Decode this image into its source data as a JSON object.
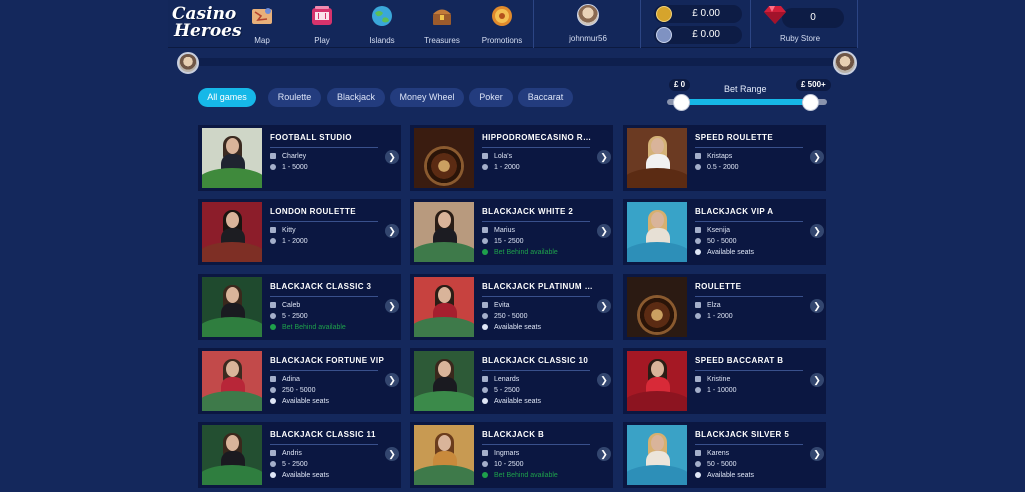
{
  "header": {
    "logo_line1": "Casino",
    "logo_line2": "Heroes",
    "nav": [
      {
        "label": "Map",
        "icon": "map-icon"
      },
      {
        "label": "Play",
        "icon": "slot-machine-icon"
      },
      {
        "label": "Islands",
        "icon": "globe-icon"
      },
      {
        "label": "Treasures",
        "icon": "treasure-chest-icon"
      },
      {
        "label": "Promotions",
        "icon": "promotion-wheel-icon"
      }
    ],
    "username": "johnmur56",
    "balances": [
      {
        "amount": "£ 0.00",
        "icon": "gold-coin-icon",
        "color": "#d6a42c"
      },
      {
        "amount": "£ 0.00",
        "icon": "silver-coin-icon",
        "color": "#9fb1d6"
      }
    ],
    "ruby_count": "0",
    "ruby_label": "Ruby Store"
  },
  "filters": {
    "items": [
      "All games",
      "Roulette",
      "Blackjack",
      "Money Wheel",
      "Poker",
      "Baccarat"
    ],
    "active": "All games"
  },
  "bet_range": {
    "label": "Bet Range",
    "min_label": "£ 0",
    "max_label": "£ 500+"
  },
  "games": [
    {
      "title": "FOOTBALL STUDIO",
      "dealer": "Charley",
      "limits": "1 - 5000",
      "status": ""
    },
    {
      "title": "HIPPODROMECASINO ROULETTE",
      "dealer": "Lola's",
      "limits": "1 - 2000",
      "status": ""
    },
    {
      "title": "SPEED ROULETTE",
      "dealer": "Kristaps",
      "limits": "0.5 - 2000",
      "status": ""
    },
    {
      "title": "LONDON ROULETTE",
      "dealer": "Kitty",
      "limits": "1 - 2000",
      "status": ""
    },
    {
      "title": "BLACKJACK WHITE 2",
      "dealer": "Marius",
      "limits": "15 - 2500",
      "status": "Bet Behind available"
    },
    {
      "title": "BLACKJACK VIP A",
      "dealer": "Ksenija",
      "limits": "50 - 5000",
      "status": "Available seats"
    },
    {
      "title": "BLACKJACK CLASSIC 3",
      "dealer": "Caleb",
      "limits": "5 - 2500",
      "status": "Bet Behind available"
    },
    {
      "title": "BLACKJACK PLATINUM VIP",
      "dealer": "Evita",
      "limits": "250 - 5000",
      "status": "Available seats"
    },
    {
      "title": "ROULETTE",
      "dealer": "Elza",
      "limits": "1 - 2000",
      "status": ""
    },
    {
      "title": "BLACKJACK FORTUNE VIP",
      "dealer": "Adina",
      "limits": "250 - 5000",
      "status": "Available seats"
    },
    {
      "title": "BLACKJACK CLASSIC 10",
      "dealer": "Lenards",
      "limits": "5 - 2500",
      "status": "Available seats"
    },
    {
      "title": "SPEED BACCARAT B",
      "dealer": "Kristine",
      "limits": "1 - 10000",
      "status": ""
    },
    {
      "title": "BLACKJACK CLASSIC 11",
      "dealer": "Andris",
      "limits": "5 - 2500",
      "status": "Available seats"
    },
    {
      "title": "BLACKJACK B",
      "dealer": "Ingmars",
      "limits": "10 - 2500",
      "status": "Bet Behind available"
    },
    {
      "title": "BLACKJACK SILVER 5",
      "dealer": "Karens",
      "limits": "50 - 5000",
      "status": "Available seats"
    }
  ],
  "colors": {
    "background": "#14285c",
    "card": "#0b1741",
    "accent": "#16b8e8",
    "bet_behind": "#1ea04b"
  }
}
